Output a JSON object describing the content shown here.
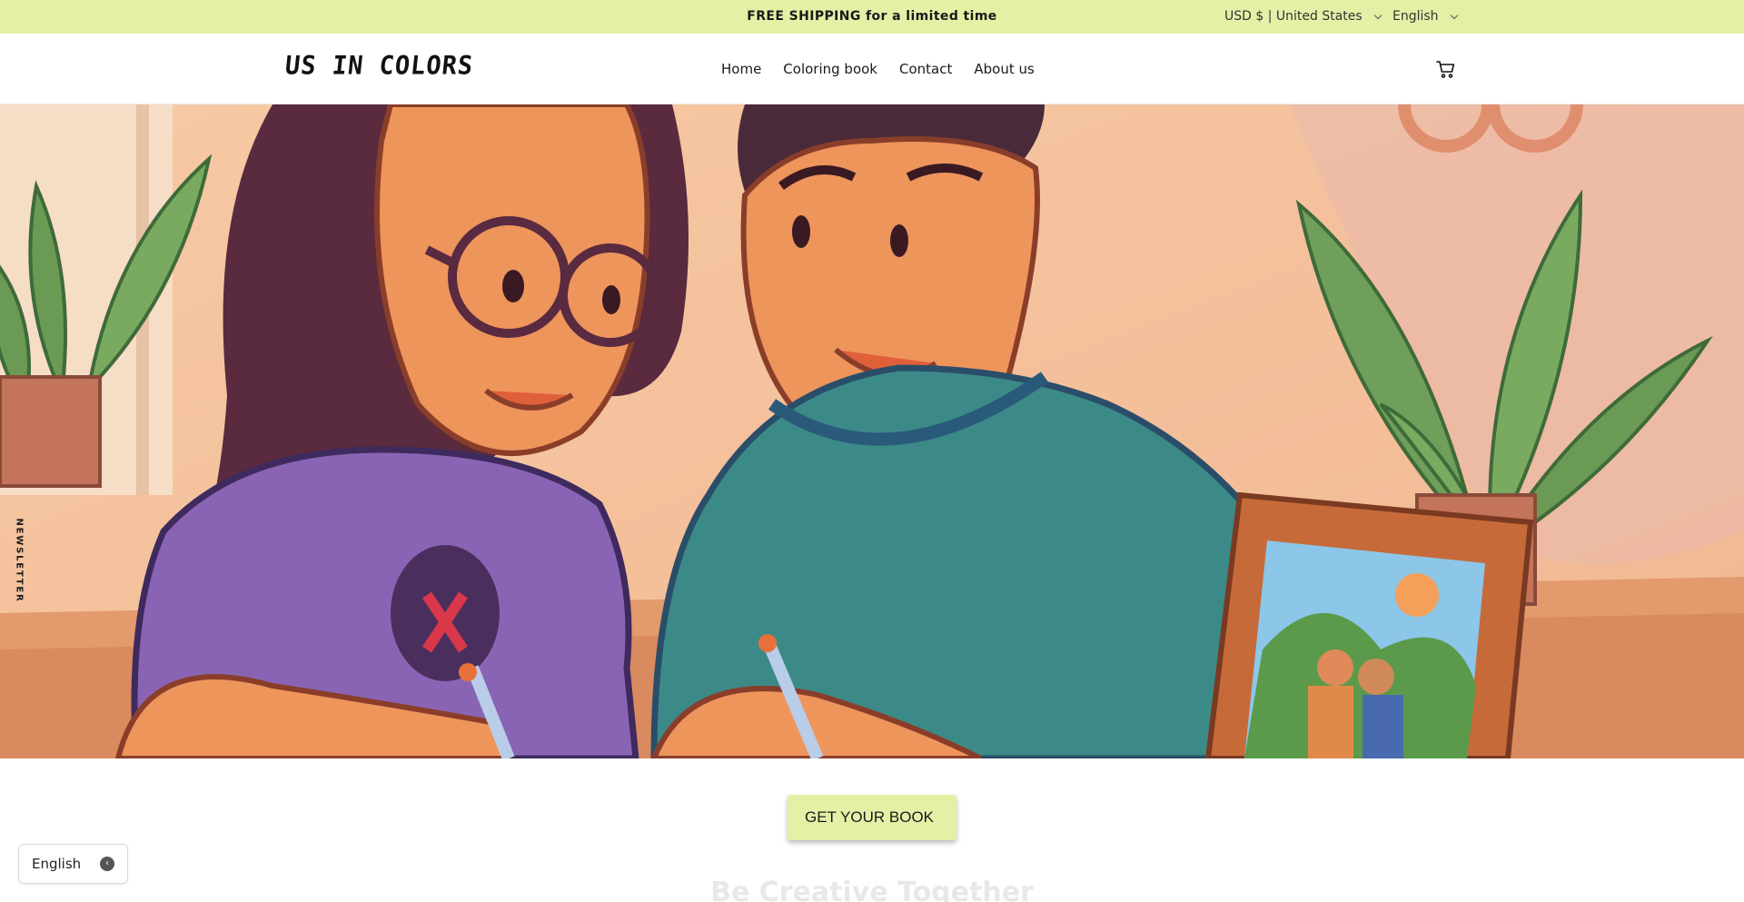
{
  "announcement": {
    "text": "FREE SHIPPING for a limited time"
  },
  "localization": {
    "currency": "USD $ | United States",
    "language": "English"
  },
  "header": {
    "logo": "US IN COLORS",
    "nav": [
      {
        "label": "Home"
      },
      {
        "label": "Coloring book"
      },
      {
        "label": "Contact"
      },
      {
        "label": "About us"
      }
    ],
    "cart_icon": "cart-icon"
  },
  "hero": {
    "image": "illustration of a couple coloring together",
    "newsletter_tab": "NEWSLETTER"
  },
  "cta": {
    "label": "GET YOUR BOOK",
    "icon": ""
  },
  "below_fold_heading": "Be Creative Together",
  "language_widget": {
    "label": "English",
    "icon": "chevron-left-icon"
  },
  "colors": {
    "accent": "#e5f0a6",
    "text": "#1a1a1a"
  }
}
